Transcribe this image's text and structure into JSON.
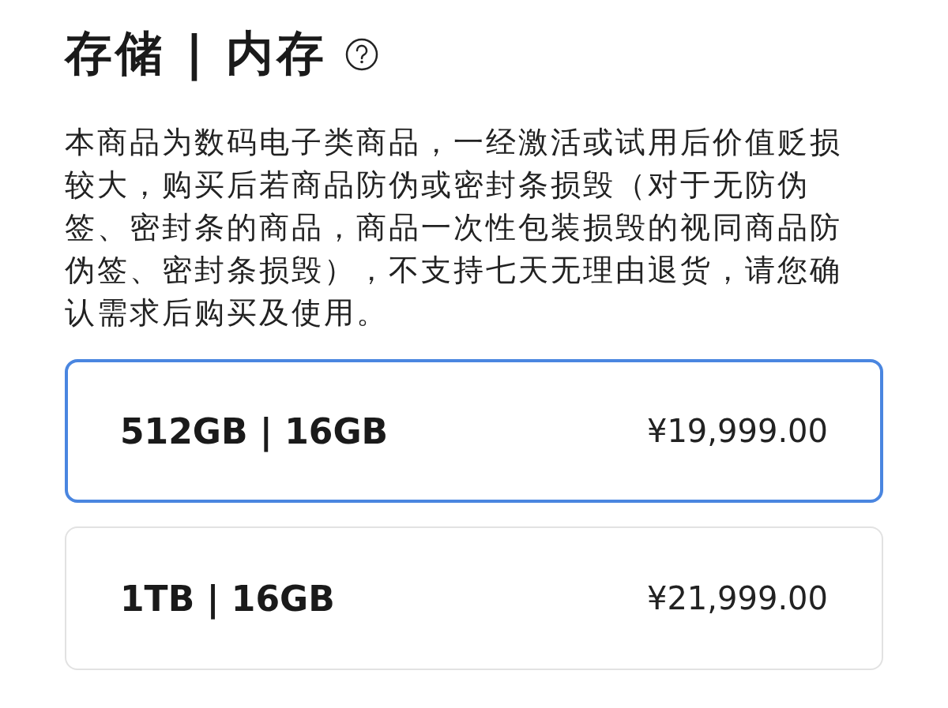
{
  "title": "存储 | 内存",
  "notice": "本商品为数码电子类商品，一经激活或试用后价值贬损较大，购买后若商品防伪或密封条损毁（对于无防伪签、密封条的商品，商品一次性包装损毁的视同商品防伪签、密封条损毁），不支持七天无理由退货，请您确认需求后购买及使用。",
  "options": [
    {
      "label": "512GB | 16GB",
      "price": "¥19,999.00",
      "selected": true
    },
    {
      "label": "1TB | 16GB",
      "price": "¥21,999.00",
      "selected": false
    }
  ]
}
